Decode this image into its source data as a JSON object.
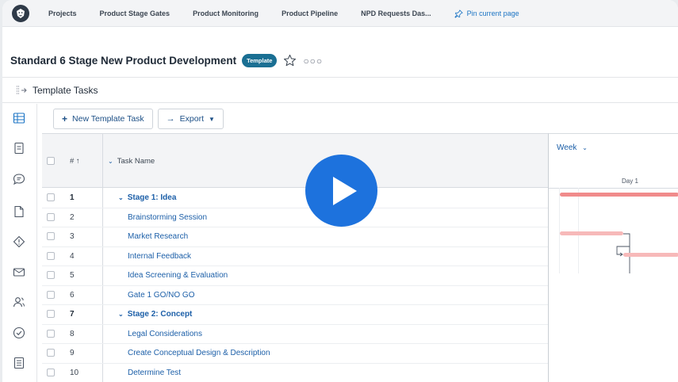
{
  "nav": {
    "items": [
      "Projects",
      "Product Stage Gates",
      "Product Monitoring",
      "Product Pipeline",
      "NPD Requests Das..."
    ],
    "pin_label": "Pin current page"
  },
  "header": {
    "title": "Standard 6 Stage New Product Development",
    "badge": "Template"
  },
  "subheader": {
    "title": "Template Tasks"
  },
  "toolbar": {
    "new_task_label": "New Template Task",
    "export_label": "Export"
  },
  "grid": {
    "col_num": "# ↑",
    "col_name": "Task Name",
    "rows": [
      {
        "num": "1",
        "name": "Stage 1: Idea",
        "stage": true
      },
      {
        "num": "2",
        "name": "Brainstorming Session",
        "stage": false
      },
      {
        "num": "3",
        "name": "Market Research",
        "stage": false
      },
      {
        "num": "4",
        "name": "Internal Feedback",
        "stage": false
      },
      {
        "num": "5",
        "name": "Idea Screening & Evaluation",
        "stage": false
      },
      {
        "num": "6",
        "name": "Gate 1 GO/NO GO",
        "stage": false
      },
      {
        "num": "7",
        "name": "Stage 2: Concept",
        "stage": true
      },
      {
        "num": "8",
        "name": "Legal Considerations",
        "stage": false
      },
      {
        "num": "9",
        "name": "Create Conceptual Design & Description",
        "stage": false
      },
      {
        "num": "10",
        "name": "Determine Test",
        "stage": false
      }
    ]
  },
  "gantt": {
    "scale_label": "Week",
    "day_label": "Day 1",
    "colors": {
      "stage_bar": "#f08b8b",
      "task_bar": "#f7b9b9"
    }
  },
  "overlay": {
    "icon": "play-icon",
    "color": "#1d72dd"
  }
}
